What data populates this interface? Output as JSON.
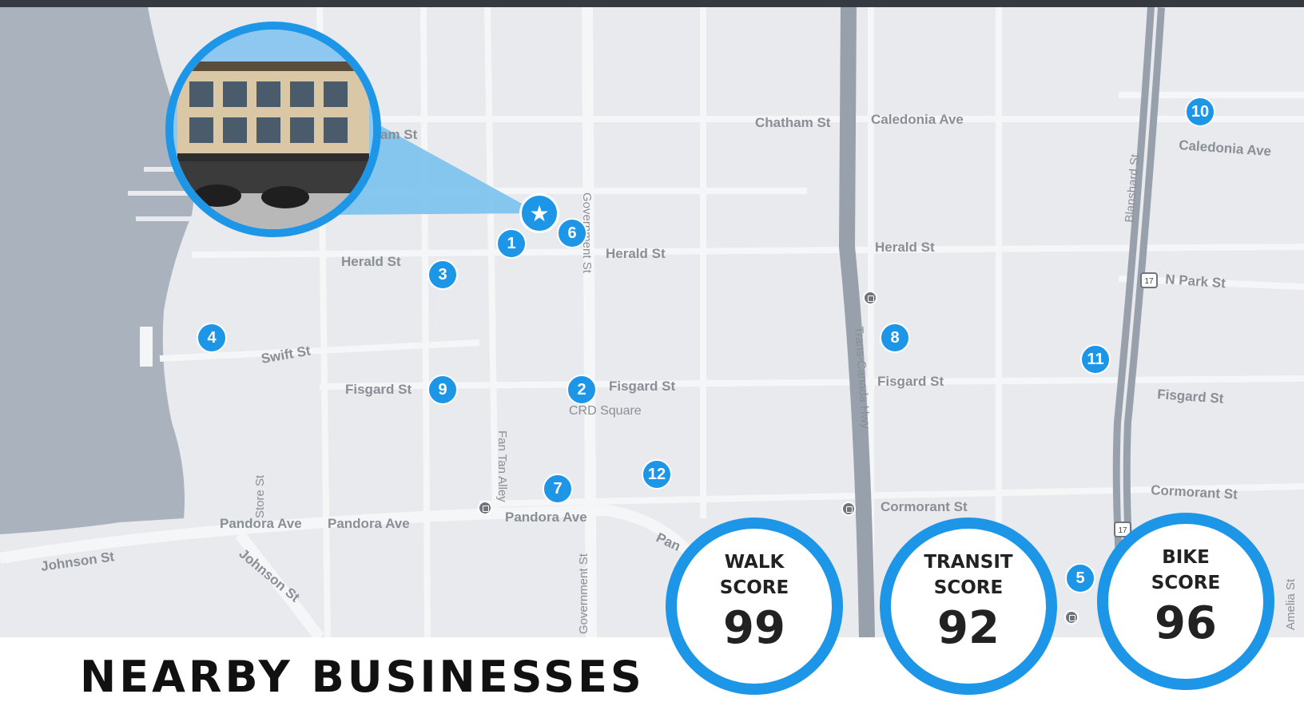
{
  "map": {
    "streets": [
      "Chatham St",
      "Caledonia Ave",
      "Caledonia Ave",
      "Herald St",
      "Herald St",
      "Herald St",
      "N Park St",
      "Swift St",
      "Fisgard St",
      "Fisgard St",
      "Fisgard St",
      "Fisgard St",
      "CRD Square",
      "Fan Tan Alley",
      "Cormorant St",
      "Cormorant St",
      "Pandora Ave",
      "Pandora Ave",
      "Pandora Ave",
      "Johnson St",
      "Johnson St",
      "Store St",
      "Government St",
      "Government St",
      "Blanshard St",
      "Trans-Canada Hwy",
      "Amelia St",
      "am St",
      "Pan"
    ],
    "highway_shield": "17",
    "markers": [
      "1",
      "2",
      "3",
      "4",
      "5",
      "6",
      "7",
      "8",
      "9",
      "10",
      "11",
      "12"
    ],
    "property_marker_icon": "star-icon",
    "transit_icon": "bus-stop-icon",
    "colors": {
      "accent": "#1e96e8",
      "map_background": "#e8eaed",
      "water": "#aab3bd",
      "highway": "#98a1ab",
      "top_bar": "#343a40"
    }
  },
  "scores": {
    "walk": {
      "label": "WALK SCORE",
      "value": "99"
    },
    "transit": {
      "label": "TRANSIT SCORE",
      "value": "92"
    },
    "bike": {
      "label": "BIKE SCORE",
      "value": "96"
    }
  },
  "section": {
    "title": "NEARBY BUSINESSES"
  }
}
